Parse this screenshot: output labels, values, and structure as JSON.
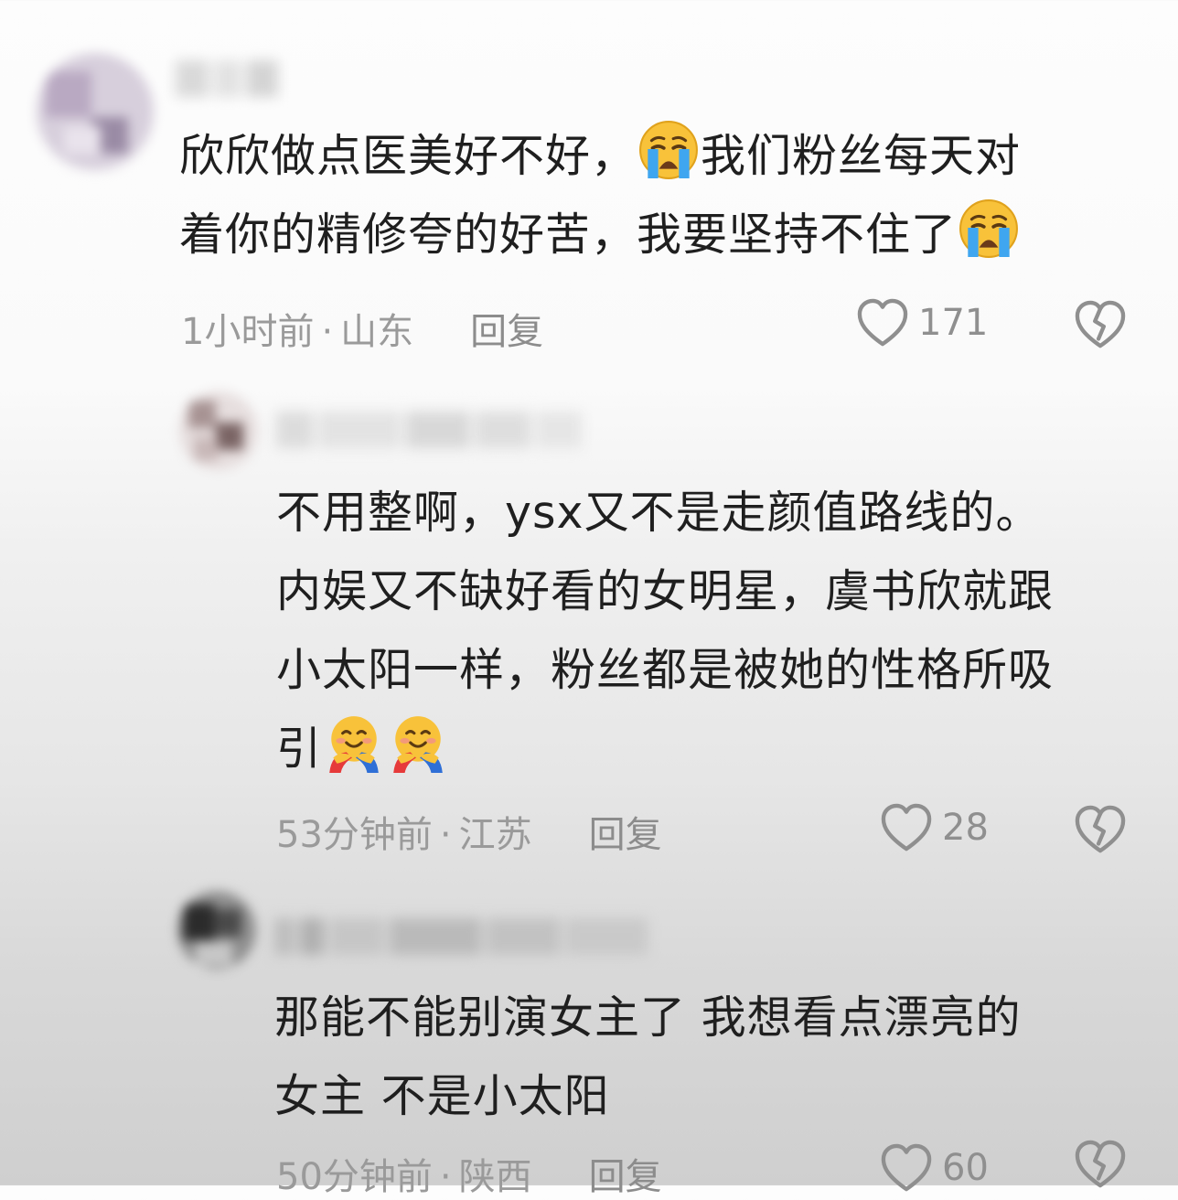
{
  "comments": [
    {
      "text_lines": [
        "欣欣做点医美好不好，",
        "我们粉丝每天对",
        "着你的精修夸的好苦，我要坚持不住了"
      ],
      "time": "1小时前",
      "location": "山东",
      "reply_label": "回复",
      "likes": "171"
    },
    {
      "text_lines": [
        "不用整啊，ysx又不是走颜值路线的。",
        "内娱又不缺好看的女明星，虞书欣就跟",
        "小太阳一样，粉丝都是被她的性格所吸",
        "引"
      ],
      "time": "53分钟前",
      "location": "江苏",
      "reply_label": "回复",
      "likes": "28"
    },
    {
      "text_lines": [
        "那能不能别演女主了 我想看点漂亮的",
        "女主 不是小太阳"
      ],
      "time": "50分钟前",
      "location": "陕西",
      "reply_label": "回复",
      "likes": "60"
    }
  ],
  "meta_separator": "·",
  "icons": {
    "like": "heart-outline-icon",
    "dislike": "broken-heart-icon",
    "cry_emoji": "loudly-crying-face-emoji",
    "hug_emoji": "hugging-face-emoji"
  },
  "colors": {
    "text": "#1f1f1f",
    "meta": "#9a9a9a",
    "icon": "#8f8f8f"
  }
}
